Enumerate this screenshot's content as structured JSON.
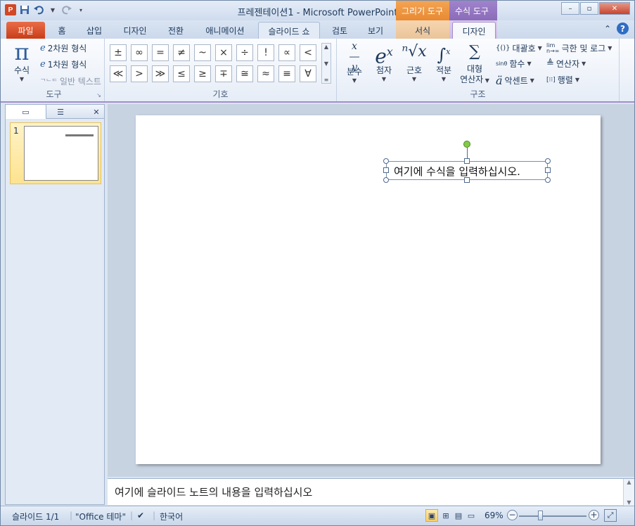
{
  "window": {
    "title": "프레젠테이션1  -  Microsoft PowerPoint",
    "context_groups": [
      {
        "label": "그리기 도구",
        "color": "#e88a32"
      },
      {
        "label": "수식 도구",
        "color": "#8a6bb9"
      }
    ],
    "controls": {
      "minimize": "–",
      "restore": "▫",
      "close": "✕"
    }
  },
  "qat": {
    "logo": "P",
    "save": "save-icon",
    "undo": "undo-icon",
    "redo": "redo-icon",
    "customize": "customize-icon"
  },
  "tabs": {
    "file": "파일",
    "home": "홈",
    "insert": "삽입",
    "design": "디자인",
    "transitions": "전환",
    "animations": "애니메이션",
    "slideshow": "슬라이드 쇼",
    "review": "검토",
    "view": "보기",
    "format": "서식",
    "eq_design": "디자인"
  },
  "ribbon": {
    "tools": {
      "label": "도구",
      "equation_icon": "π",
      "equation": "수식",
      "professional": "2차원 형식",
      "linear": "1차원 형식",
      "normal_text": "일반 텍스트"
    },
    "symbols": {
      "label": "기호",
      "items": [
        "±",
        "∞",
        "=",
        "≠",
        "~",
        "×",
        "÷",
        "!",
        "∝",
        "<",
        "≪",
        ">",
        "≫",
        "≤",
        "≥",
        "∓",
        "≅",
        "≈",
        "≡",
        "∀"
      ]
    },
    "structures": {
      "label": "구조",
      "fraction": "분수",
      "script": "첨자",
      "radical": "근호",
      "integral": "적분",
      "large_operator_1": "대형",
      "large_operator_2": "연산자",
      "bracket": "대괄호",
      "function": "함수",
      "accent": "악센트",
      "limit_log": "극한 및 로그",
      "operator": "연산자",
      "matrix": "행렬"
    }
  },
  "slides_panel": {
    "slide_number": "1"
  },
  "slide": {
    "equation_placeholder": "여기에 수식을 입력하십시오."
  },
  "notes": {
    "placeholder": "여기에 슬라이드 노트의 내용을 입력하십시오"
  },
  "status": {
    "slide_info": "슬라이드 1/1",
    "theme": "\"Office 테마\"",
    "language": "한국어",
    "zoom": "69%"
  }
}
